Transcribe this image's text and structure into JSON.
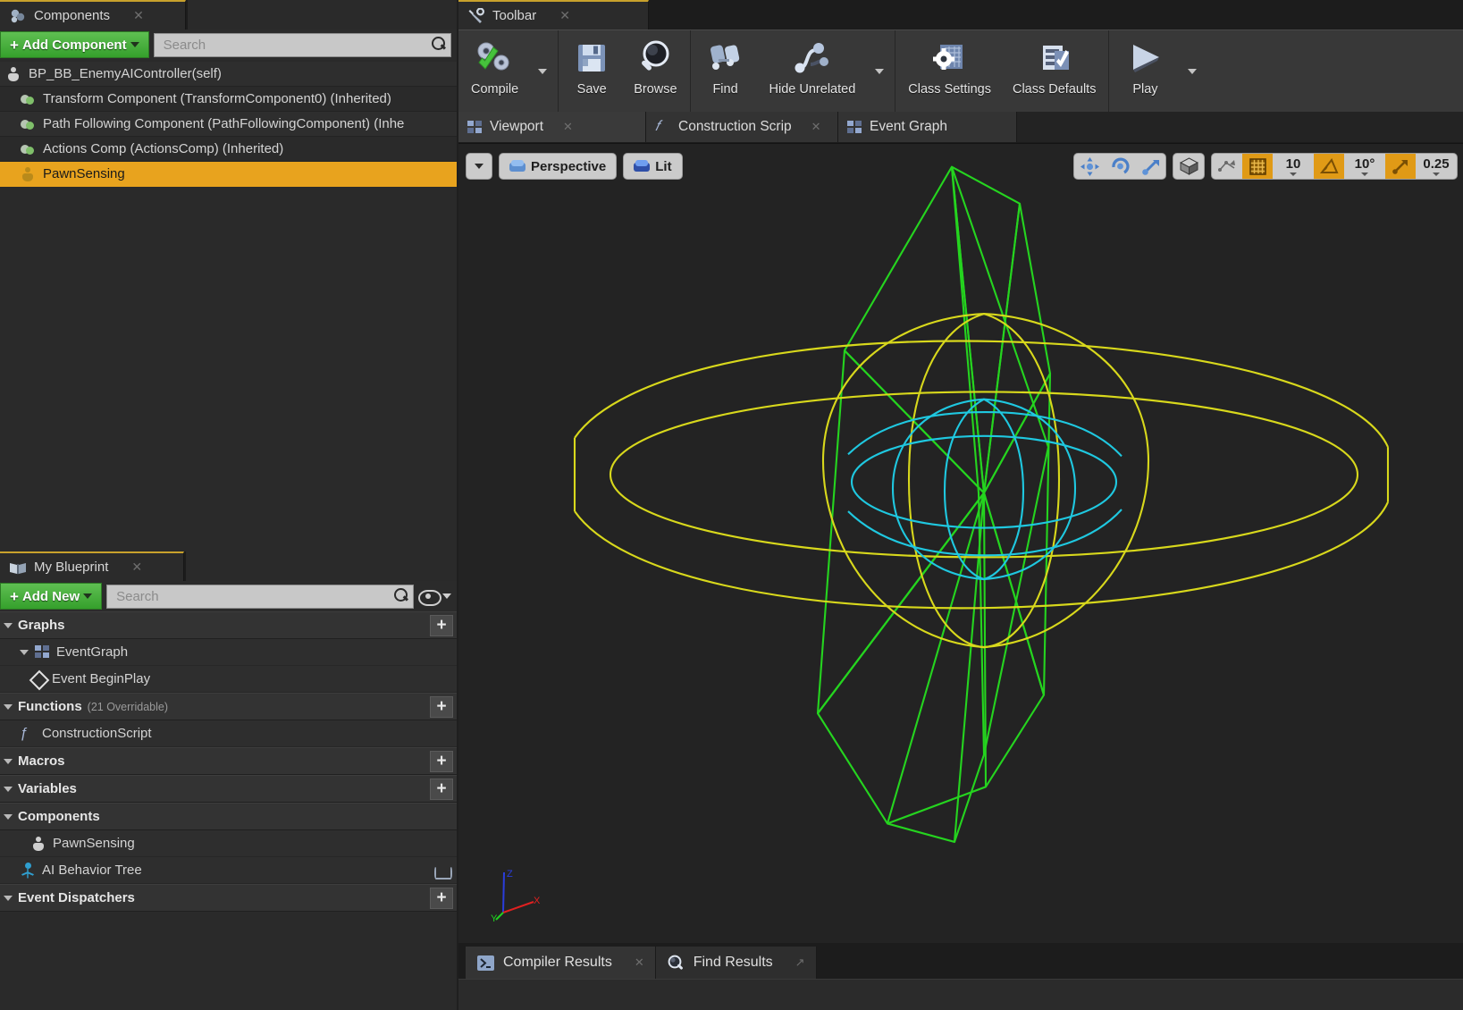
{
  "components_panel": {
    "tab_label": "Components",
    "tab_icon": "components-icon",
    "add_component_label": "Add Component",
    "search_placeholder": "Search",
    "tree": [
      {
        "label": "BP_BB_EnemyAIController(self)",
        "icon": "pawn-icon",
        "indent": 0,
        "selected": false
      },
      {
        "label": "Transform Component (TransformComponent0) (Inherited)",
        "icon": "sphere-icon",
        "indent": 1,
        "selected": false
      },
      {
        "label": "Path Following Component (PathFollowingComponent) (Inhe",
        "icon": "sphere-icon",
        "indent": 1,
        "selected": false
      },
      {
        "label": "Actions Comp (ActionsComp) (Inherited)",
        "icon": "sphere-icon",
        "indent": 1,
        "selected": false
      },
      {
        "label": "PawnSensing",
        "icon": "pawn-sensing-icon",
        "indent": 1,
        "selected": true
      }
    ]
  },
  "my_blueprint": {
    "tab_label": "My Blueprint",
    "add_new_label": "Add New",
    "search_placeholder": "Search",
    "sections": [
      {
        "title": "Graphs",
        "sub": "",
        "has_add": true,
        "items": [
          {
            "label": "EventGraph",
            "icon": "graph-icon",
            "indent": 1
          },
          {
            "label": "Event BeginPlay",
            "icon": "event-node-icon",
            "indent": 2
          }
        ]
      },
      {
        "title": "Functions",
        "sub": "(21 Overridable)",
        "has_add": true,
        "items": [
          {
            "label": "ConstructionScript",
            "icon": "function-icon",
            "indent": 1
          }
        ]
      },
      {
        "title": "Macros",
        "sub": "",
        "has_add": true,
        "items": []
      },
      {
        "title": "Variables",
        "sub": "",
        "has_add": true,
        "items": []
      },
      {
        "title": "Components",
        "sub": "",
        "has_add": false,
        "items": [
          {
            "label": "PawnSensing",
            "icon": "pawn-sensing-icon",
            "indent": 2
          },
          {
            "label": "AI Behavior Tree",
            "icon": "behavior-tree-icon",
            "indent": 1,
            "trailing": "object-picker-icon"
          }
        ]
      },
      {
        "title": "Event Dispatchers",
        "sub": "",
        "has_add": true,
        "items": []
      }
    ]
  },
  "toolbar": {
    "tab_label": "Toolbar",
    "tab_icon": "wrench-icon",
    "buttons": [
      {
        "label": "Compile",
        "icon": "compile-icon",
        "has_dropdown": true
      },
      {
        "label": "Save",
        "icon": "save-icon",
        "has_dropdown": false
      },
      {
        "label": "Browse",
        "icon": "browse-icon",
        "has_dropdown": false
      },
      {
        "label": "Find",
        "icon": "find-icon",
        "has_dropdown": false
      },
      {
        "label": "Hide Unrelated",
        "icon": "hide-unrelated-icon",
        "has_dropdown": true
      },
      {
        "label": "Class Settings",
        "icon": "class-settings-icon",
        "has_dropdown": false
      },
      {
        "label": "Class Defaults",
        "icon": "class-defaults-icon",
        "has_dropdown": false
      },
      {
        "label": "Play",
        "icon": "play-icon",
        "has_dropdown": true
      }
    ]
  },
  "document_tabs": [
    {
      "label": "Viewport",
      "icon": "viewport-icon",
      "active": true,
      "closable": true
    },
    {
      "label": "Construction Scrip",
      "icon": "function-icon",
      "active": false,
      "closable": true
    },
    {
      "label": "Event Graph",
      "icon": "graph-icon",
      "active": false,
      "closable": false
    }
  ],
  "viewport": {
    "view_mode_label": "Perspective",
    "shading_label": "Lit",
    "transform_tools": [
      "translate-icon",
      "rotate-icon",
      "scale-icon"
    ],
    "coord_space_icon": "world-space-icon",
    "surface_snap_icon": "surface-snap-icon",
    "grid_snap": {
      "icon": "grid-snap-icon",
      "enabled": true,
      "value": "10"
    },
    "rotation_snap": {
      "icon": "rotation-snap-icon",
      "enabled": true,
      "value": "10°"
    },
    "scale_snap": {
      "icon": "scale-snap-icon",
      "enabled": true,
      "value": "0.25"
    },
    "axis_gizmo": {
      "x_label": "X",
      "y_label": "Y",
      "z_label": "Z"
    },
    "wireframe": {
      "sight_color": "#25d41f",
      "hearing_color": "#d8d81c",
      "los_hearing_color": "#1fc8e0",
      "background": "#232323"
    }
  },
  "bottom_tabs": [
    {
      "label": "Compiler Results",
      "icon": "compiler-results-icon",
      "active": true,
      "closable": true
    },
    {
      "label": "Find Results",
      "icon": "find-results-icon",
      "active": false,
      "closable": true
    }
  ],
  "colors": {
    "accent_orange": "#e8a31e",
    "green_button": "#3ca52f",
    "tab_highlight": "#c8a12c"
  }
}
